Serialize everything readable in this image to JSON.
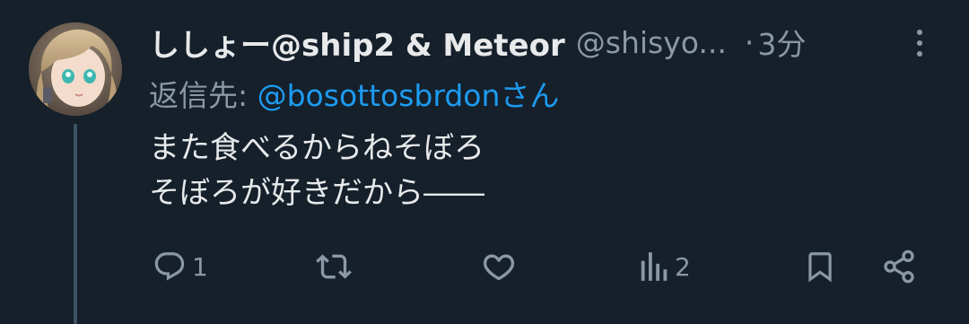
{
  "tweet": {
    "display_name": "ししょー@ship2 & Meteor",
    "handle": "@shisyo...",
    "separator": "·",
    "time": "3分",
    "reply_label": "返信先: ",
    "reply_mention": "@bosottosbrdonさん",
    "body_lines": [
      "また食べるからねそぼろ",
      "そぼろが好きだから――"
    ]
  },
  "actions": {
    "reply_count": "1",
    "retweet_count": "",
    "like_count": "",
    "views_count": "2"
  },
  "colors": {
    "background": "#15202b",
    "text": "#e7e9ea",
    "secondary": "#8b98a5",
    "link": "#1d9bf0",
    "thread_line": "#3d5466"
  },
  "icons": [
    "more-vertical-icon",
    "reply-icon",
    "retweet-icon",
    "like-icon",
    "views-icon",
    "bookmark-icon",
    "share-icon"
  ]
}
